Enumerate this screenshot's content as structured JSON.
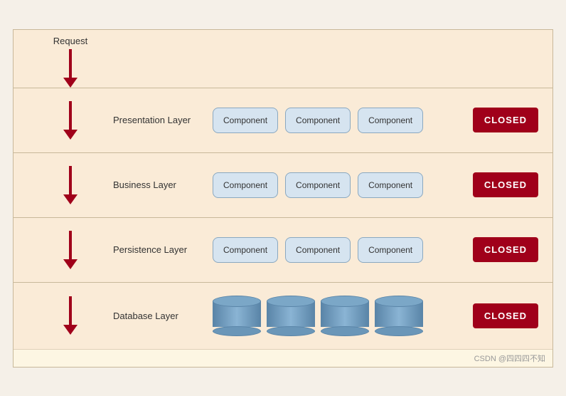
{
  "diagram": {
    "request_label": "Request",
    "layers": [
      {
        "id": "presentation",
        "label": "Presentation Layer",
        "components": [
          "Component",
          "Component",
          "Component"
        ],
        "badge": "CLOSED",
        "has_db": false
      },
      {
        "id": "business",
        "label": "Business Layer",
        "components": [
          "Component",
          "Component",
          "Component"
        ],
        "badge": "CLOSED",
        "has_db": false
      },
      {
        "id": "persistence",
        "label": "Persistence Layer",
        "components": [
          "Component",
          "Component",
          "Component"
        ],
        "badge": "CLOSED",
        "has_db": false
      },
      {
        "id": "database",
        "label": "Database Layer",
        "components": [],
        "badge": "CLOSED",
        "has_db": true,
        "db_count": 4
      }
    ],
    "watermark": "CSDN @四四四不知"
  }
}
